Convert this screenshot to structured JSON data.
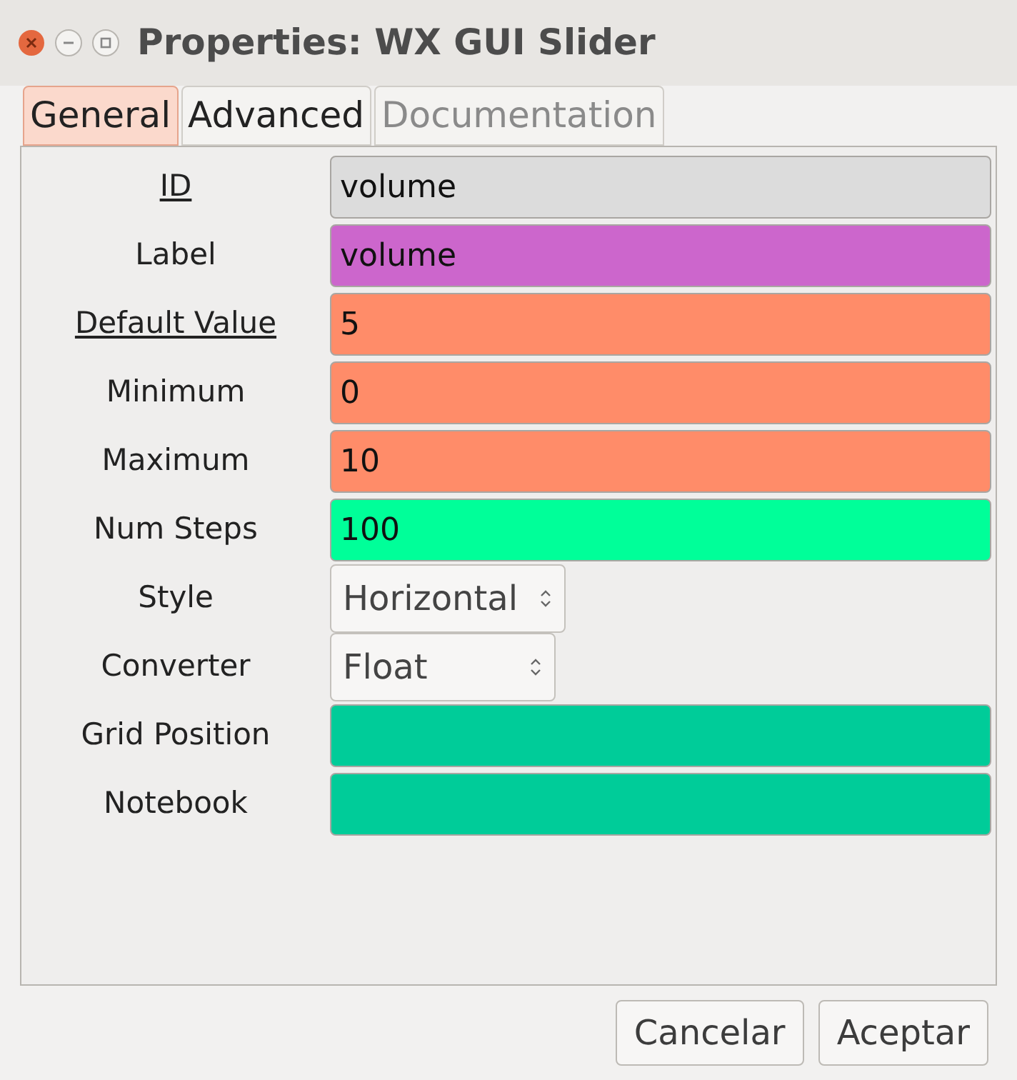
{
  "window": {
    "title": "Properties: WX GUI Slider"
  },
  "tabs": [
    {
      "label": "General",
      "selected": true,
      "disabled": false
    },
    {
      "label": "Advanced",
      "selected": false,
      "disabled": false
    },
    {
      "label": "Documentation",
      "selected": false,
      "disabled": true
    }
  ],
  "fields": [
    {
      "kind": "text",
      "label": "ID",
      "underlined": true,
      "value": "volume",
      "color": "#dcdcdc"
    },
    {
      "kind": "text",
      "label": "Label",
      "underlined": false,
      "value": "volume",
      "color": "#cc66cc"
    },
    {
      "kind": "text",
      "label": "Default Value",
      "underlined": true,
      "value": "5",
      "color": "#ff8c69"
    },
    {
      "kind": "text",
      "label": "Minimum",
      "underlined": false,
      "value": "0",
      "color": "#ff8c69"
    },
    {
      "kind": "text",
      "label": "Maximum",
      "underlined": false,
      "value": "10",
      "color": "#ff8c69"
    },
    {
      "kind": "text",
      "label": "Num Steps",
      "underlined": false,
      "value": "100",
      "color": "#00ff99"
    },
    {
      "kind": "select",
      "label": "Style",
      "underlined": false,
      "value": "Horizontal"
    },
    {
      "kind": "select",
      "label": "Converter",
      "underlined": false,
      "value": "Float"
    },
    {
      "kind": "text",
      "label": "Grid Position",
      "underlined": false,
      "color": "#00cc99"
    },
    {
      "kind": "text",
      "label": "Notebook",
      "underlined": false,
      "color": "#00cc99"
    }
  ],
  "buttons": [
    "Cancelar",
    "Aceptar"
  ]
}
